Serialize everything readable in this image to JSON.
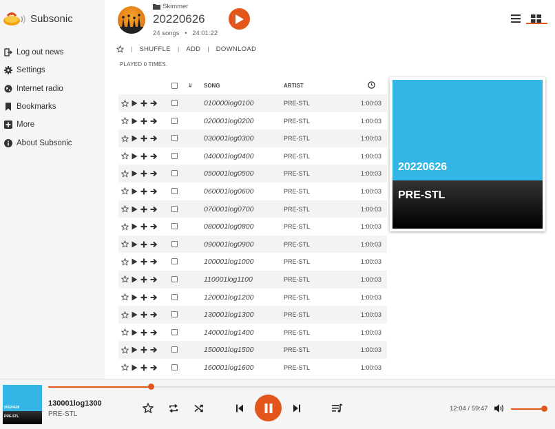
{
  "app": {
    "name": "Subsonic"
  },
  "sidebar": {
    "items": [
      {
        "label": "Log out news",
        "icon": "logout-icon"
      },
      {
        "label": "Settings",
        "icon": "gear-icon"
      },
      {
        "label": "Internet radio",
        "icon": "globe-icon"
      },
      {
        "label": "Bookmarks",
        "icon": "bookmark-icon"
      },
      {
        "label": "More",
        "icon": "plus-square-icon"
      },
      {
        "label": "About Subsonic",
        "icon": "info-icon"
      }
    ]
  },
  "album": {
    "breadcrumb": "Skimmer",
    "title": "20220626",
    "song_count": "24 songs",
    "duration": "24:01:22",
    "played": "PLAYED 0 TIMES."
  },
  "actions": {
    "shuffle": "SHUFFLE",
    "add": "ADD",
    "download": "DOWNLOAD"
  },
  "table": {
    "headers": {
      "num": "#",
      "song": "SONG",
      "artist": "ARTIST"
    },
    "rows": [
      {
        "song": "010000log0100",
        "artist": "PRE-STL",
        "duration": "1:00:03"
      },
      {
        "song": "020001log0200",
        "artist": "PRE-STL",
        "duration": "1:00:03"
      },
      {
        "song": "030001log0300",
        "artist": "PRE-STL",
        "duration": "1:00:03"
      },
      {
        "song": "040001log0400",
        "artist": "PRE-STL",
        "duration": "1:00:03"
      },
      {
        "song": "050001log0500",
        "artist": "PRE-STL",
        "duration": "1:00:03"
      },
      {
        "song": "060001log0600",
        "artist": "PRE-STL",
        "duration": "1:00:03"
      },
      {
        "song": "070001log0700",
        "artist": "PRE-STL",
        "duration": "1:00:03"
      },
      {
        "song": "080001log0800",
        "artist": "PRE-STL",
        "duration": "1:00:03"
      },
      {
        "song": "090001log0900",
        "artist": "PRE-STL",
        "duration": "1:00:03"
      },
      {
        "song": "100001log1000",
        "artist": "PRE-STL",
        "duration": "1:00:03"
      },
      {
        "song": "110001log1100",
        "artist": "PRE-STL",
        "duration": "1:00:03"
      },
      {
        "song": "120001log1200",
        "artist": "PRE-STL",
        "duration": "1:00:03"
      },
      {
        "song": "130001log1300",
        "artist": "PRE-STL",
        "duration": "1:00:03"
      },
      {
        "song": "140001log1400",
        "artist": "PRE-STL",
        "duration": "1:00:03"
      },
      {
        "song": "150001log1500",
        "artist": "PRE-STL",
        "duration": "1:00:03"
      },
      {
        "song": "160001log1600",
        "artist": "PRE-STL",
        "duration": "1:00:03"
      }
    ]
  },
  "cover": {
    "title": "20220626",
    "artist": "PRE-STL",
    "color_top": "#33b6e6"
  },
  "player": {
    "title": "130001log1300",
    "artist": "PRE-STL",
    "time": "12:04 / 59:47",
    "progress": 0.202,
    "volume": 1.0
  },
  "colors": {
    "accent": "#e2551b"
  }
}
